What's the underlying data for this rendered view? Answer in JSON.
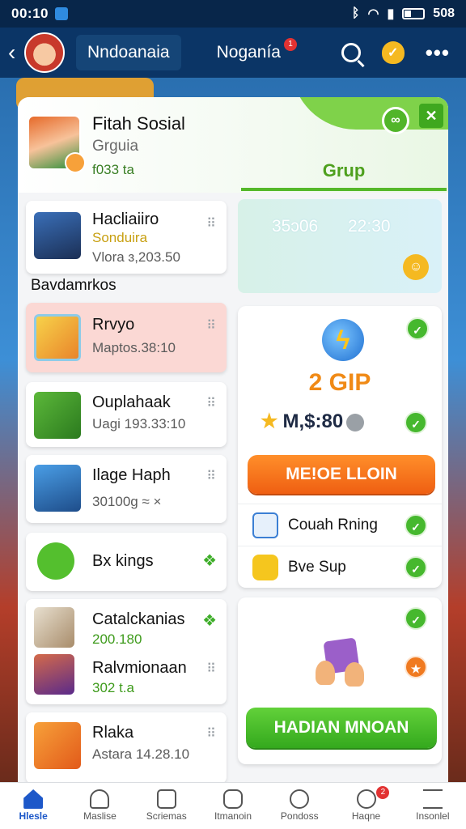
{
  "status_bar": {
    "time": "00:10",
    "battery": "508"
  },
  "app_bar": {
    "tabs": [
      {
        "label": "Nndoanaia"
      },
      {
        "label": "Noganía"
      }
    ],
    "notification_count": "1"
  },
  "profile": {
    "name": "Fitah Sosial",
    "subtitle": "Grguia",
    "meta": "f033 ta",
    "group_tab": "Grup"
  },
  "list": {
    "items": [
      {
        "title": "Hacliaiiro",
        "line2": "Sonduira",
        "line3": "Vlora ɜ,203.50"
      },
      {
        "title": "Rrvyo",
        "line2": "Maptos.38:10"
      },
      {
        "title": "Ouplahaak",
        "line2": "Uagi 193.33:10"
      },
      {
        "title": "Ilage Haph",
        "line2": "30100g ≈ ×"
      },
      {
        "title": "Bx kings"
      },
      {
        "title": "Catalckanias",
        "line2": "200.180"
      },
      {
        "title": "Ralvmionaan",
        "line2": "302 t.a"
      },
      {
        "title": "Rlaka",
        "line2": "Astara 14.28.10"
      }
    ],
    "section_label": "Bavdamrkos"
  },
  "stat_box": {
    "value1": "35ɔ06",
    "value2": "22:30"
  },
  "reward": {
    "amount": "2 GIP",
    "price": "M,$:80",
    "button_label": "ME!OE LLOIN",
    "options": [
      {
        "label": "Couah Rning"
      },
      {
        "label": "Bve Sup"
      }
    ]
  },
  "promo": {
    "button_label": "HADIAN MNOAN"
  },
  "bottom_nav": {
    "items": [
      {
        "label": "Hlesle"
      },
      {
        "label": "Maslise"
      },
      {
        "label": "Scriemas"
      },
      {
        "label": "Itmanoin"
      },
      {
        "label": "Pondoss"
      },
      {
        "label": "Haqne"
      },
      {
        "label": "Insonlel"
      }
    ],
    "badge": "2"
  },
  "colors": {
    "accent_green": "#46b82e",
    "accent_orange": "#f07a20",
    "nav_active": "#1d58c9",
    "header_bg": "#0b3566"
  }
}
